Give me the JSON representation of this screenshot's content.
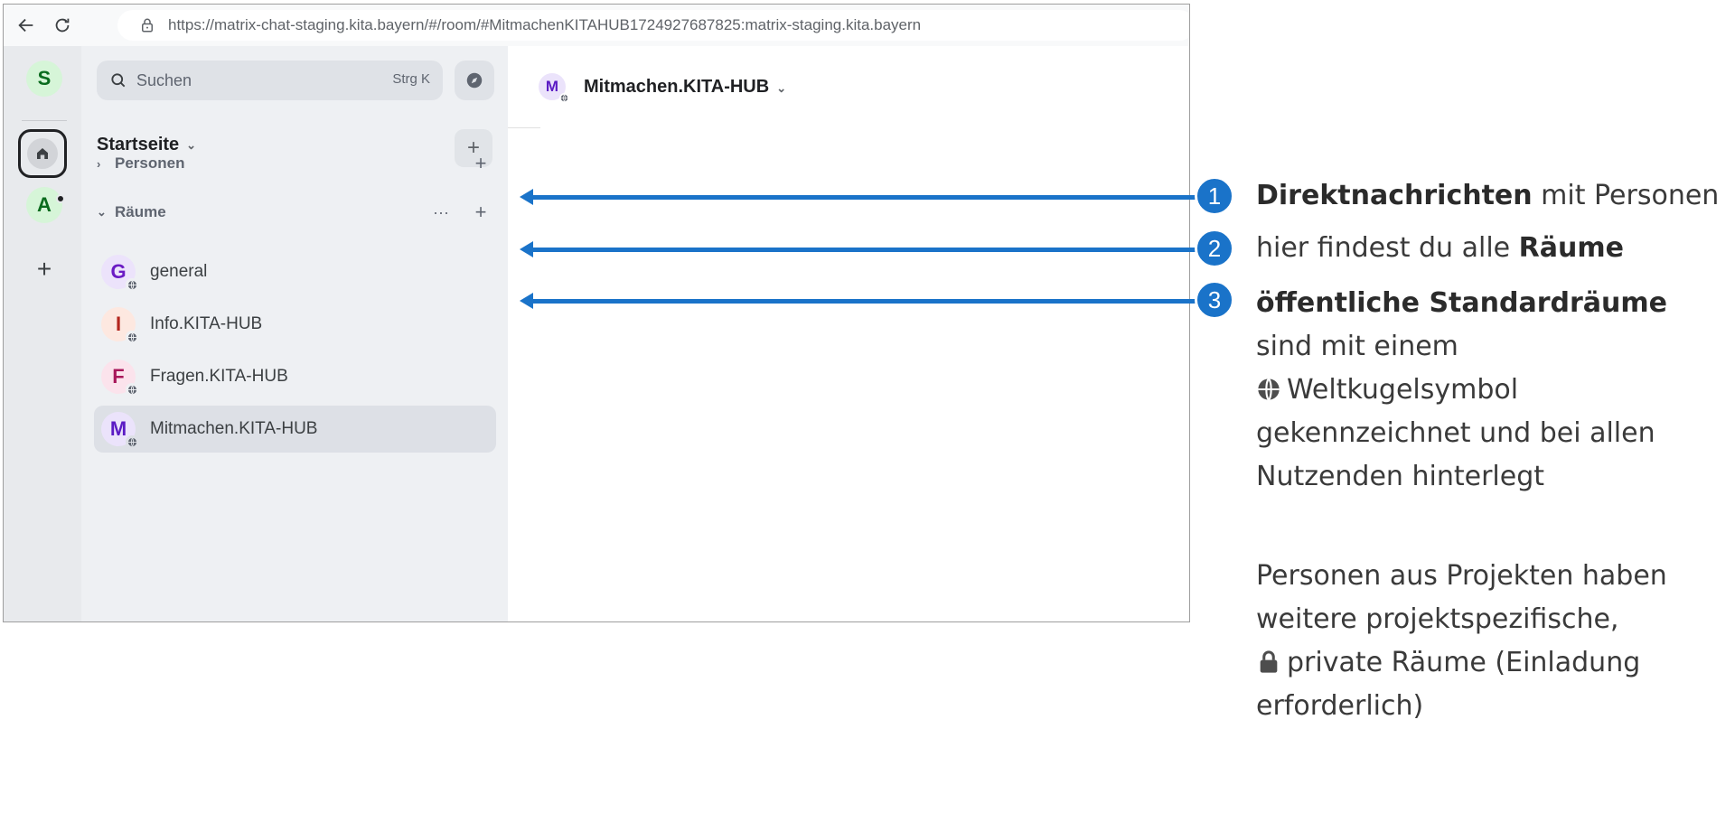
{
  "browser": {
    "url_host": "https://matrix-chat-staging.kita.bayern",
    "url_rest": "/#/room/#MitmachenKITAHUB1724927687825:matrix-staging.kita.bayern"
  },
  "spaces": {
    "user_initial": "S",
    "space_initial": "A",
    "add_label": "+"
  },
  "roomlist": {
    "search_placeholder": "Suchen",
    "search_shortcut": "Strg K",
    "home_title": "Startseite",
    "home_add": "+",
    "sections": [
      {
        "label": "Personen",
        "add": "+"
      },
      {
        "label": "Räume",
        "more": "···",
        "add": "+"
      }
    ],
    "rooms": [
      {
        "initial": "G",
        "name": "general",
        "color": "#6b1bc4",
        "bg": "#ece3fb"
      },
      {
        "initial": "I",
        "name": "Info.KITA-HUB",
        "color": "#b3261e",
        "bg": "#fde8e0"
      },
      {
        "initial": "F",
        "name": "Fragen.KITA-HUB",
        "color": "#a8175a",
        "bg": "#fbe3ec"
      },
      {
        "initial": "M",
        "name": "Mitmachen.KITA-HUB",
        "color": "#5b1bc4",
        "bg": "#ebe3fb"
      }
    ]
  },
  "main": {
    "room_initial": "M",
    "room_title": "Mitmachen.KITA-HUB"
  },
  "annotations": [
    {
      "num": "1",
      "bold": "Direktnachrichten",
      "rest": " mit Personen"
    },
    {
      "num": "2",
      "pre": "hier findest du alle ",
      "bold": "Räume"
    },
    {
      "num": "3",
      "bold": "öffentliche Standardräume",
      "line2": "sind mit einem",
      "line3": "Weltkugelsymbol",
      "line4": "gekennzeichnet und bei allen",
      "line5": "Nutzenden hinterlegt"
    }
  ],
  "note": {
    "line1": "Personen aus Projekten haben",
    "line2": "weitere projektspezifische,",
    "line3": "private Räume (Einladung",
    "line4": "erforderlich)"
  },
  "colors": {
    "accent": "#1a73c9",
    "space_avatar_bg": "#d6f5d8",
    "space_avatar_fg": "#0a6b1e"
  }
}
